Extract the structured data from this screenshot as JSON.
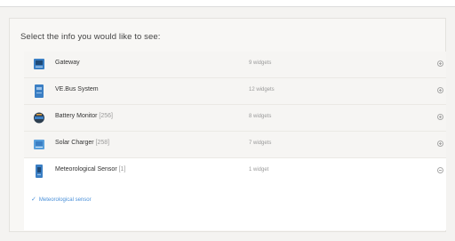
{
  "heading": "Select the info you would like to see:",
  "devices": [
    {
      "name": "Gateway",
      "instance": "",
      "widgets": "9 widgets",
      "icon": "gateway-icon",
      "expanded": false
    },
    {
      "name": "VE.Bus System",
      "instance": "",
      "widgets": "12 widgets",
      "icon": "inverter-icon",
      "expanded": false
    },
    {
      "name": "Battery Monitor",
      "instance": "[256]",
      "widgets": "8 widgets",
      "icon": "battery-monitor-icon",
      "expanded": false
    },
    {
      "name": "Solar Charger",
      "instance": "[258]",
      "widgets": "7 widgets",
      "icon": "solar-charger-icon",
      "expanded": false
    },
    {
      "name": "Meteorological Sensor",
      "instance": "[1]",
      "widgets": "1 widget",
      "icon": "sensor-icon",
      "expanded": true
    }
  ],
  "expanded_widgets": [
    {
      "label": "Meteorological sensor",
      "checked": true
    }
  ],
  "colors": {
    "accent": "#4a90d9",
    "icon_blue": "#3b7fc4",
    "icon_dark": "#2d3e50"
  }
}
